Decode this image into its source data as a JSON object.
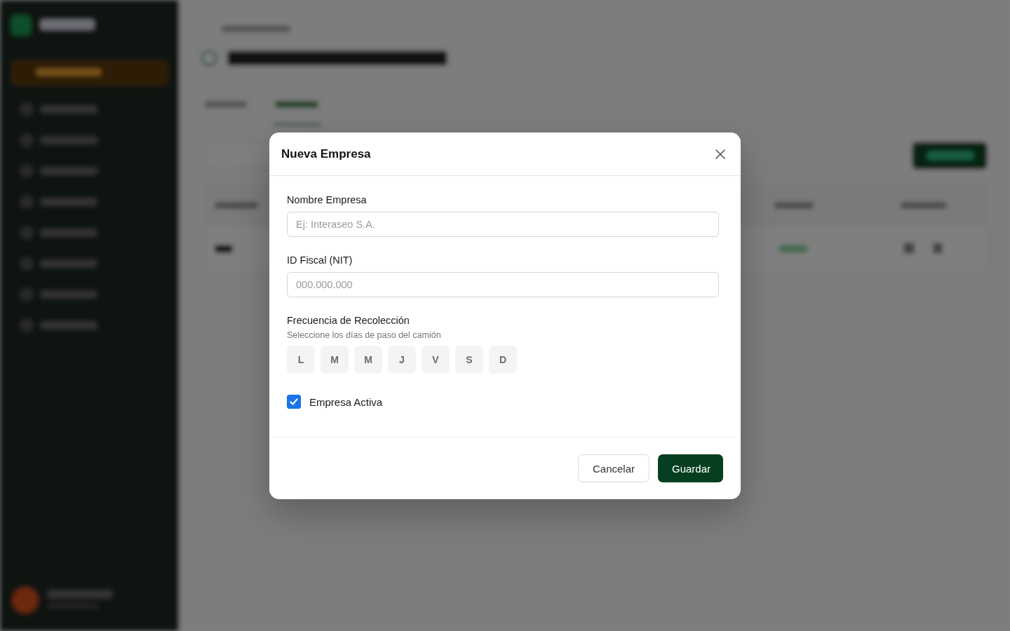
{
  "dialog": {
    "title": "Nueva Empresa",
    "fields": [
      {
        "label": "Nombre Empresa",
        "placeholder": "Ej: Interaseo S.A."
      },
      {
        "label": "ID Fiscal (NIT)",
        "placeholder": "000.000.000"
      }
    ],
    "frequency": {
      "label": "Frecuencia de Recolección",
      "hint": "Seleccione los días de paso del camión",
      "days": [
        {
          "label": "L",
          "selected": false
        },
        {
          "label": "M",
          "selected": false
        },
        {
          "label": "M",
          "selected": false
        },
        {
          "label": "J",
          "selected": false
        },
        {
          "label": "V",
          "selected": false
        },
        {
          "label": "S",
          "selected": false
        },
        {
          "label": "D",
          "selected": false
        }
      ]
    },
    "active": {
      "label": "Empresa Activa",
      "checked": true
    },
    "buttons": [
      {
        "label": "Cancelar",
        "kind": "secondary"
      },
      {
        "label": "Guardar",
        "kind": "primary"
      }
    ]
  }
}
